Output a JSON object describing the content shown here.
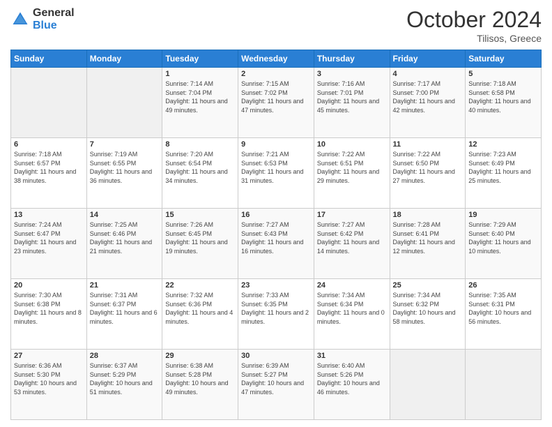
{
  "header": {
    "logo_line1": "General",
    "logo_line2": "Blue",
    "month": "October 2024",
    "location": "Tilisos, Greece"
  },
  "days_of_week": [
    "Sunday",
    "Monday",
    "Tuesday",
    "Wednesday",
    "Thursday",
    "Friday",
    "Saturday"
  ],
  "weeks": [
    [
      {
        "day": "",
        "content": ""
      },
      {
        "day": "",
        "content": ""
      },
      {
        "day": "1",
        "content": "Sunrise: 7:14 AM\nSunset: 7:04 PM\nDaylight: 11 hours and 49 minutes."
      },
      {
        "day": "2",
        "content": "Sunrise: 7:15 AM\nSunset: 7:02 PM\nDaylight: 11 hours and 47 minutes."
      },
      {
        "day": "3",
        "content": "Sunrise: 7:16 AM\nSunset: 7:01 PM\nDaylight: 11 hours and 45 minutes."
      },
      {
        "day": "4",
        "content": "Sunrise: 7:17 AM\nSunset: 7:00 PM\nDaylight: 11 hours and 42 minutes."
      },
      {
        "day": "5",
        "content": "Sunrise: 7:18 AM\nSunset: 6:58 PM\nDaylight: 11 hours and 40 minutes."
      }
    ],
    [
      {
        "day": "6",
        "content": "Sunrise: 7:18 AM\nSunset: 6:57 PM\nDaylight: 11 hours and 38 minutes."
      },
      {
        "day": "7",
        "content": "Sunrise: 7:19 AM\nSunset: 6:55 PM\nDaylight: 11 hours and 36 minutes."
      },
      {
        "day": "8",
        "content": "Sunrise: 7:20 AM\nSunset: 6:54 PM\nDaylight: 11 hours and 34 minutes."
      },
      {
        "day": "9",
        "content": "Sunrise: 7:21 AM\nSunset: 6:53 PM\nDaylight: 11 hours and 31 minutes."
      },
      {
        "day": "10",
        "content": "Sunrise: 7:22 AM\nSunset: 6:51 PM\nDaylight: 11 hours and 29 minutes."
      },
      {
        "day": "11",
        "content": "Sunrise: 7:22 AM\nSunset: 6:50 PM\nDaylight: 11 hours and 27 minutes."
      },
      {
        "day": "12",
        "content": "Sunrise: 7:23 AM\nSunset: 6:49 PM\nDaylight: 11 hours and 25 minutes."
      }
    ],
    [
      {
        "day": "13",
        "content": "Sunrise: 7:24 AM\nSunset: 6:47 PM\nDaylight: 11 hours and 23 minutes."
      },
      {
        "day": "14",
        "content": "Sunrise: 7:25 AM\nSunset: 6:46 PM\nDaylight: 11 hours and 21 minutes."
      },
      {
        "day": "15",
        "content": "Sunrise: 7:26 AM\nSunset: 6:45 PM\nDaylight: 11 hours and 19 minutes."
      },
      {
        "day": "16",
        "content": "Sunrise: 7:27 AM\nSunset: 6:43 PM\nDaylight: 11 hours and 16 minutes."
      },
      {
        "day": "17",
        "content": "Sunrise: 7:27 AM\nSunset: 6:42 PM\nDaylight: 11 hours and 14 minutes."
      },
      {
        "day": "18",
        "content": "Sunrise: 7:28 AM\nSunset: 6:41 PM\nDaylight: 11 hours and 12 minutes."
      },
      {
        "day": "19",
        "content": "Sunrise: 7:29 AM\nSunset: 6:40 PM\nDaylight: 11 hours and 10 minutes."
      }
    ],
    [
      {
        "day": "20",
        "content": "Sunrise: 7:30 AM\nSunset: 6:38 PM\nDaylight: 11 hours and 8 minutes."
      },
      {
        "day": "21",
        "content": "Sunrise: 7:31 AM\nSunset: 6:37 PM\nDaylight: 11 hours and 6 minutes."
      },
      {
        "day": "22",
        "content": "Sunrise: 7:32 AM\nSunset: 6:36 PM\nDaylight: 11 hours and 4 minutes."
      },
      {
        "day": "23",
        "content": "Sunrise: 7:33 AM\nSunset: 6:35 PM\nDaylight: 11 hours and 2 minutes."
      },
      {
        "day": "24",
        "content": "Sunrise: 7:34 AM\nSunset: 6:34 PM\nDaylight: 11 hours and 0 minutes."
      },
      {
        "day": "25",
        "content": "Sunrise: 7:34 AM\nSunset: 6:32 PM\nDaylight: 10 hours and 58 minutes."
      },
      {
        "day": "26",
        "content": "Sunrise: 7:35 AM\nSunset: 6:31 PM\nDaylight: 10 hours and 56 minutes."
      }
    ],
    [
      {
        "day": "27",
        "content": "Sunrise: 6:36 AM\nSunset: 5:30 PM\nDaylight: 10 hours and 53 minutes."
      },
      {
        "day": "28",
        "content": "Sunrise: 6:37 AM\nSunset: 5:29 PM\nDaylight: 10 hours and 51 minutes."
      },
      {
        "day": "29",
        "content": "Sunrise: 6:38 AM\nSunset: 5:28 PM\nDaylight: 10 hours and 49 minutes."
      },
      {
        "day": "30",
        "content": "Sunrise: 6:39 AM\nSunset: 5:27 PM\nDaylight: 10 hours and 47 minutes."
      },
      {
        "day": "31",
        "content": "Sunrise: 6:40 AM\nSunset: 5:26 PM\nDaylight: 10 hours and 46 minutes."
      },
      {
        "day": "",
        "content": ""
      },
      {
        "day": "",
        "content": ""
      }
    ]
  ]
}
